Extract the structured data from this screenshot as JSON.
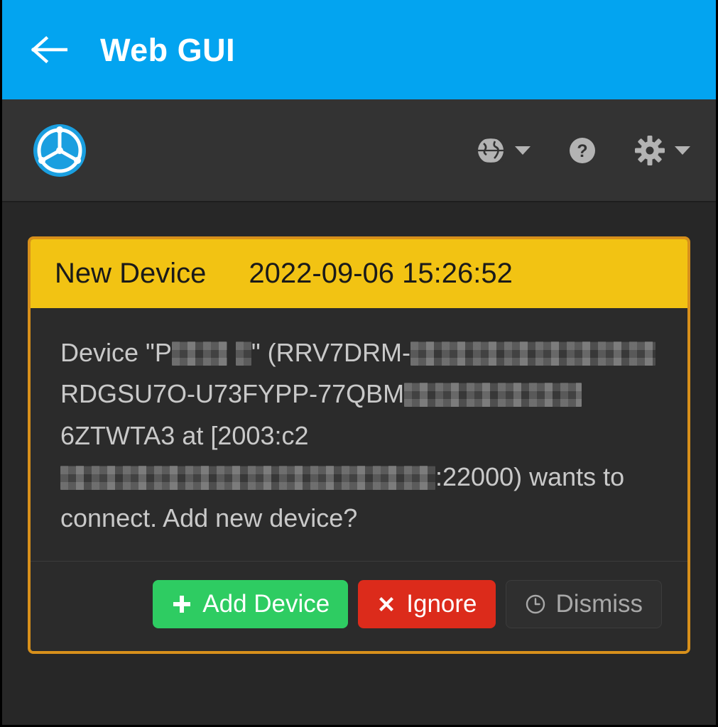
{
  "actionbar": {
    "back_icon": "back-arrow-icon",
    "title": "Web GUI"
  },
  "navbar": {
    "brand_icon": "syncthing-logo-icon",
    "items": [
      {
        "icon": "globe-icon",
        "label": "",
        "has_caret": true
      },
      {
        "icon": "help-question-icon",
        "label": "",
        "has_caret": false
      },
      {
        "icon": "gear-icon",
        "label": "",
        "has_caret": true
      }
    ]
  },
  "notification": {
    "title": "New Device",
    "timestamp": "2022-09-06 15:26:52",
    "message": {
      "line1_prefix": "Device \"P",
      "line1_name_redacted": "",
      "line1_mid": "\" (RRV7DRM-",
      "line1_id_redacted": "",
      "line2_prefix": "RDGSU7O-U73FYPP-77QBM",
      "line2_redacted": "",
      "line3": "6ZTWTA3 at",
      "line4_prefix": "[2003:c2",
      "line4_redacted": "",
      "line4_suffix": ":22000)",
      "line5": "wants to connect. Add new device?"
    },
    "buttons": {
      "add": "Add Device",
      "ignore": "Ignore",
      "dismiss": "Dismiss"
    }
  },
  "colors": {
    "actionbar_blue": "#03a4f0",
    "panel_border": "#d8901b",
    "panel_heading": "#f2c313",
    "add_green": "#2ecc62",
    "ignore_red": "#dc2b1b",
    "background_dark": "#272727",
    "navbar_dark": "#333333"
  }
}
